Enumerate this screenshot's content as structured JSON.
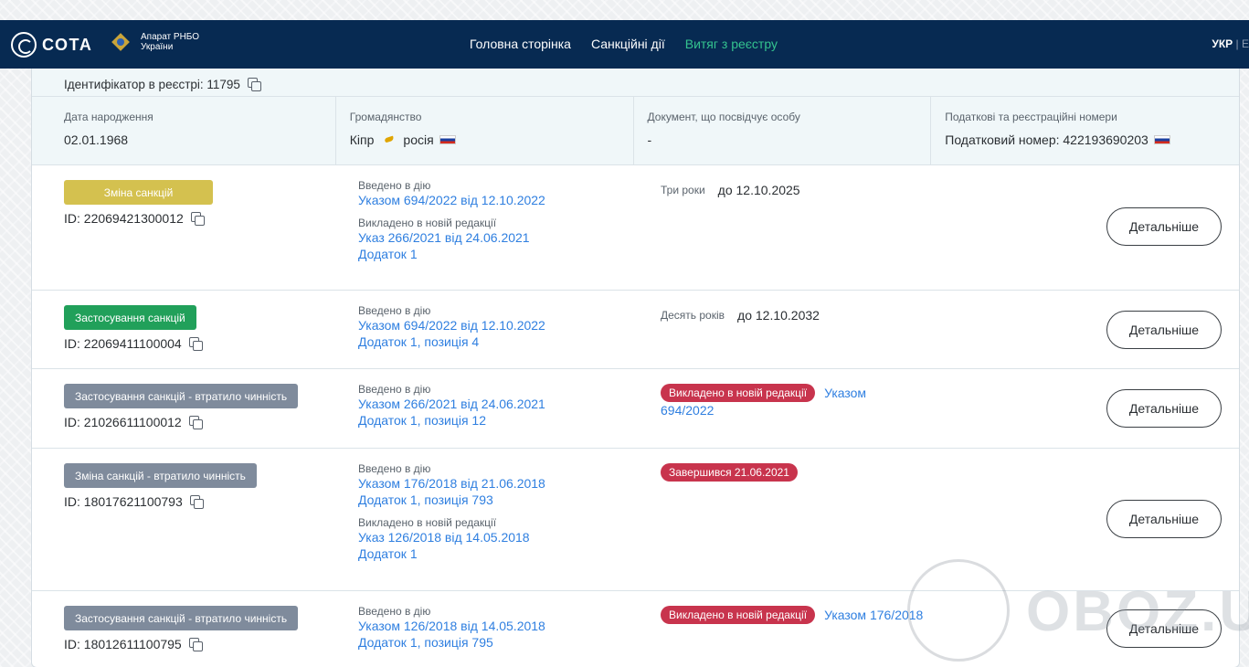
{
  "header": {
    "logo_text": "СОТА",
    "org_line1": "Апарат РНБО",
    "org_line2": "України",
    "nav": [
      "Головна сторінка",
      "Санкційні дії",
      "Витяг з реєстру"
    ],
    "lang_active": "УКР",
    "lang_other": "E",
    "colors": {
      "bar": "#072a52",
      "active": "#34c38f"
    }
  },
  "record": {
    "registry_id_label": "Ідентифікатор в реєстрі: 11795",
    "birth_label": "Дата народження",
    "birth_value": "02.01.1968",
    "citizenship_label": "Громадянство",
    "citizenship_1": "Кіпр",
    "citizenship_2": "росія",
    "document_label": "Документ, що посвідчує особу",
    "document_value": "-",
    "tax_label": "Податкові та реєстраційні номери",
    "tax_value": "Податковий номер: 422193690203"
  },
  "sanctions": [
    {
      "type": "Зміна санкцій",
      "id": "ID: 22069421300012",
      "intro_label": "Введено в дію",
      "intro_links": [
        "Указом 694/2022 від 12.10.2022"
      ],
      "rev_label": "Викладено в новій редакції",
      "rev_links": [
        "Указ 266/2021 від 24.06.2021",
        "Додаток 1"
      ],
      "term": "Три роки",
      "until": "до 12.10.2025",
      "button": "Детальніше"
    },
    {
      "type": "Застосування санкцій",
      "id": "ID: 22069411100004",
      "intro_label": "Введено в дію",
      "intro_links": [
        "Указом 694/2022 від 12.10.2022",
        "Додаток 1, позиція 4"
      ],
      "term": "Десять років",
      "until": "до 12.10.2032",
      "button": "Детальніше"
    },
    {
      "type": "Застосування санкцій - втратило чинність",
      "id": "ID: 21026611100012",
      "intro_label": "Введено в дію",
      "intro_links": [
        "Указом 266/2021 від 24.06.2021",
        "Додаток 1, позиція 12"
      ],
      "status": "Викладено в новій редакції",
      "status_link_1": "Указом",
      "status_link_2": "694/2022",
      "button": "Детальніше"
    },
    {
      "type": "Зміна санкцій - втратило чинність",
      "id": "ID: 18017621100793",
      "intro_label": "Введено в дію",
      "intro_links": [
        "Указом 176/2018 від 21.06.2018",
        "Додаток 1, позиція 793"
      ],
      "rev_label": "Викладено в новій редакції",
      "rev_links": [
        "Указ 126/2018 від 14.05.2018",
        "Додаток 1"
      ],
      "status": "Завершився 21.06.2021",
      "button": "Детальніше"
    },
    {
      "type": "Застосування санкцій - втратило чинність",
      "id": "ID: 18012611100795",
      "intro_label": "Введено в дію",
      "intro_links": [
        "Указом 126/2018 від 14.05.2018",
        "Додаток 1, позиція 795"
      ],
      "status": "Викладено в новій редакції",
      "status_link_1": "Указом 176/2018",
      "button": "Детальніше"
    }
  ],
  "watermark": "OBOZ.UA"
}
